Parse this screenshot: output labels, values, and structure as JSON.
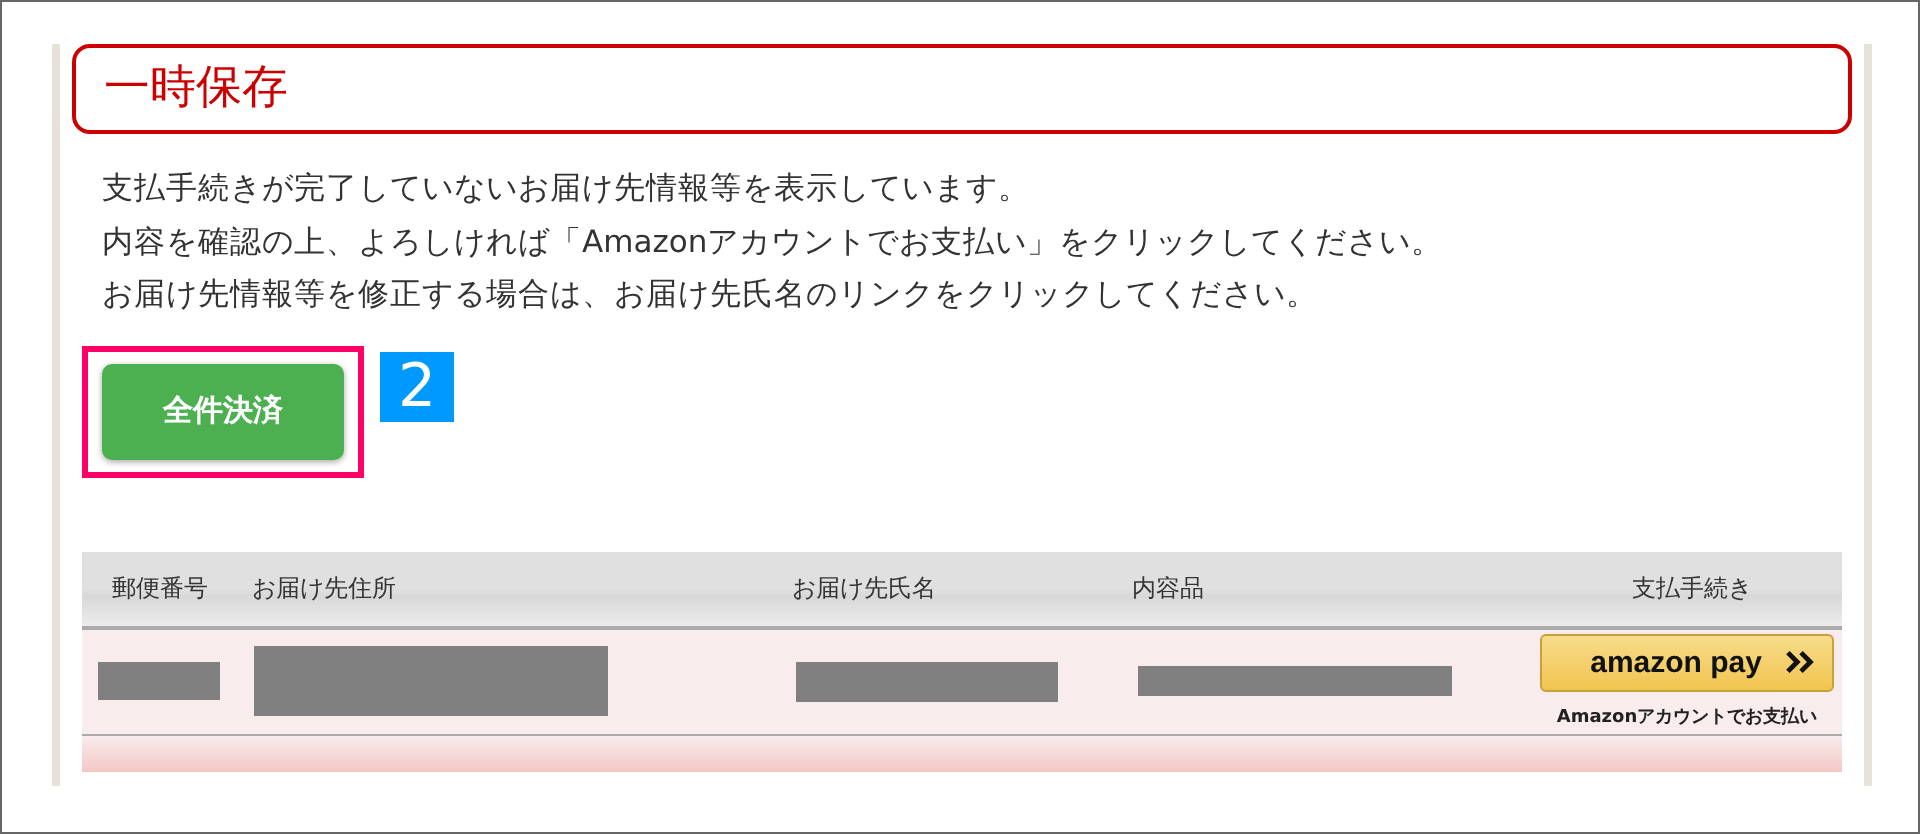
{
  "title": "一時保存",
  "message_lines": [
    "支払手続きが完了していないお届け先情報等を表示しています。",
    "内容を確認の上、よろしければ「Amazonアカウントでお支払い」をクリックしてください。",
    "お届け先情報等を修正する場合は、お届け先氏名のリンクをクリックしてください。"
  ],
  "pay_all_button": {
    "label": "全件決済",
    "highlighted": true
  },
  "step_badge": "2",
  "table": {
    "columns": [
      "郵便番号",
      "お届け先住所",
      "お届け先氏名",
      "内容品",
      "支払手続き"
    ],
    "rows": [
      {
        "cells": [
          {
            "kind": "redacted"
          },
          {
            "kind": "redacted"
          },
          {
            "kind": "redacted"
          },
          {
            "kind": "redacted"
          },
          {
            "kind": "payment",
            "logo": "amazon pay",
            "caption": "Amazonアカウントでお支払い"
          }
        ]
      }
    ]
  }
}
